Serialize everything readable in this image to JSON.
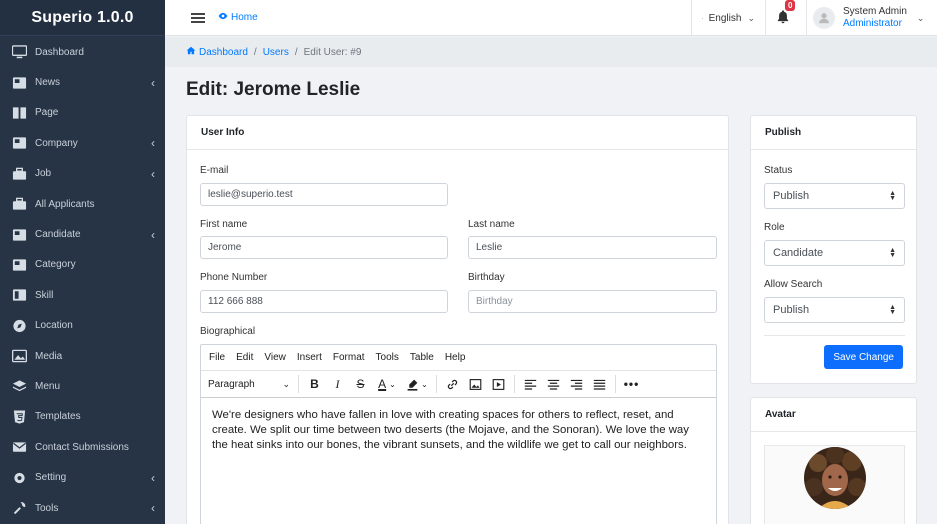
{
  "app": {
    "title": "Superio 1.0.0"
  },
  "sidebar": {
    "items": [
      {
        "label": "Dashboard",
        "icon": "monitor-icon",
        "has_children": false
      },
      {
        "label": "News",
        "icon": "news-icon",
        "has_children": true
      },
      {
        "label": "Page",
        "icon": "page-icon",
        "has_children": false
      },
      {
        "label": "Company",
        "icon": "company-icon",
        "has_children": true
      },
      {
        "label": "Job",
        "icon": "briefcase-icon",
        "has_children": true
      },
      {
        "label": "All Applicants",
        "icon": "briefcase-icon",
        "has_children": false
      },
      {
        "label": "Candidate",
        "icon": "candidate-icon",
        "has_children": true
      },
      {
        "label": "Category",
        "icon": "category-icon",
        "has_children": false
      },
      {
        "label": "Skill",
        "icon": "skill-icon",
        "has_children": false
      },
      {
        "label": "Location",
        "icon": "compass-icon",
        "has_children": false
      },
      {
        "label": "Media",
        "icon": "image-icon",
        "has_children": false
      },
      {
        "label": "Menu",
        "icon": "layers-icon",
        "has_children": false
      },
      {
        "label": "Templates",
        "icon": "html5-icon",
        "has_children": false
      },
      {
        "label": "Contact Submissions",
        "icon": "envelope-icon",
        "has_children": false
      },
      {
        "label": "Setting",
        "icon": "cog-icon",
        "has_children": true
      },
      {
        "label": "Tools",
        "icon": "wrench-icon",
        "has_children": true
      }
    ]
  },
  "topbar": {
    "home_label": "Home",
    "language": "English",
    "notification_count": "0",
    "user_name": "System Admin",
    "user_role": "Administrator"
  },
  "breadcrumb": {
    "dashboard": "Dashboard",
    "users": "Users",
    "current": "Edit User: #9"
  },
  "page": {
    "title": "Edit: Jerome Leslie"
  },
  "user_info": {
    "header": "User Info",
    "email_label": "E-mail",
    "email_value": "leslie@superio.test",
    "first_name_label": "First name",
    "first_name_value": "Jerome",
    "last_name_label": "Last name",
    "last_name_value": "Leslie",
    "phone_label": "Phone Number",
    "phone_value": "112 666 888",
    "birthday_label": "Birthday",
    "birthday_placeholder": "Birthday",
    "bio_label": "Biographical"
  },
  "editor": {
    "menu": [
      "File",
      "Edit",
      "View",
      "Insert",
      "Format",
      "Tools",
      "Table",
      "Help"
    ],
    "format_select": "Paragraph",
    "content": "We're designers who have fallen in love with creating spaces for others to reflect, reset, and create. We split our time between two deserts (the Mojave, and the Sonoran). We love the way the heat sinks into our bones, the vibrant sunsets, and the wildlife we get to call our neighbors."
  },
  "publish": {
    "header": "Publish",
    "status_label": "Status",
    "status_value": "Publish",
    "role_label": "Role",
    "role_value": "Candidate",
    "allow_search_label": "Allow Search",
    "allow_search_value": "Publish",
    "save_label": "Save Change"
  },
  "avatar": {
    "header": "Avatar"
  },
  "colors": {
    "sidebar_bg": "#263445",
    "accent": "#0d6efd",
    "badge": "#dc3545"
  }
}
